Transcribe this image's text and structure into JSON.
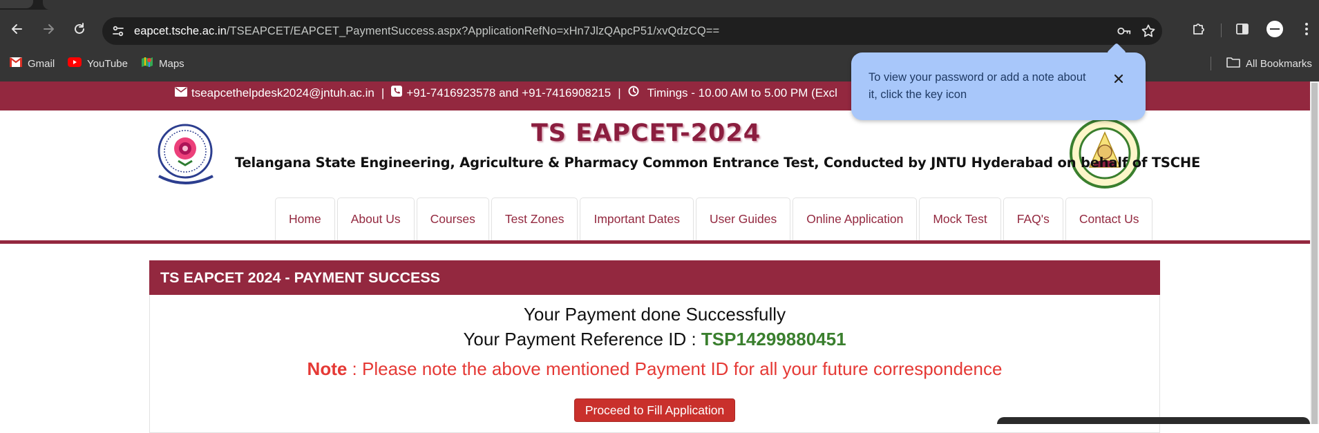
{
  "browser": {
    "url_host": "eapcet.tsche.ac.in",
    "url_path": "/TSEAPCET/EAPCET_PaymentSuccess.aspx?ApplicationRefNo=xHn7JlzQApcP51/xvQdzCQ==",
    "nav_icons": [
      "back-icon",
      "forward-icon",
      "reload-icon",
      "site-settings-icon"
    ],
    "omnibox_icons": [
      "key-icon",
      "star-icon"
    ],
    "toolbar_icons": [
      "extensions-icon",
      "side-panel-icon",
      "profile-icon",
      "menu-icon"
    ],
    "bookmarks": [
      {
        "label": "Gmail",
        "icon": "gmail-icon"
      },
      {
        "label": "YouTube",
        "icon": "youtube-icon"
      },
      {
        "label": "Maps",
        "icon": "maps-icon"
      }
    ],
    "all_bookmarks_label": "All Bookmarks",
    "password_tooltip": "To view your password or add a note about it, click the key icon"
  },
  "site": {
    "contact": {
      "email": "tseapcethelpdesk2024@jntuh.ac.in",
      "phone": "+91-7416923578 and +91-7416908215",
      "timings": "Timings - 10.00 AM to 5.00 PM (Excl"
    },
    "title": "TS EAPCET-2024",
    "subtitle": "Telangana State Engineering, Agriculture & Pharmacy Common Entrance Test, Conducted by JNTU Hyderabad on behalf of TSCHE",
    "menu": [
      "Home",
      "About Us",
      "Courses",
      "Test Zones",
      "Important Dates",
      "User Guides",
      "Online Application",
      "Mock Test",
      "FAQ's",
      "Contact Us"
    ]
  },
  "payment": {
    "heading": "TS EAPCET 2024 - PAYMENT SUCCESS",
    "line1": "Your Payment done Successfully",
    "ref_label": "Your Payment Reference ID : ",
    "ref_id": "TSP14299880451",
    "note_label": "Note",
    "note_text": " : Please note the above mentioned Payment ID for all your future correspondence",
    "button_label": "Proceed to Fill Application"
  },
  "colors": {
    "brand_maroon": "#93283f",
    "success_green": "#3a7f2e",
    "note_red": "#e53935",
    "button_red": "#c9302c",
    "tooltip_blue": "#a8c7fa"
  }
}
